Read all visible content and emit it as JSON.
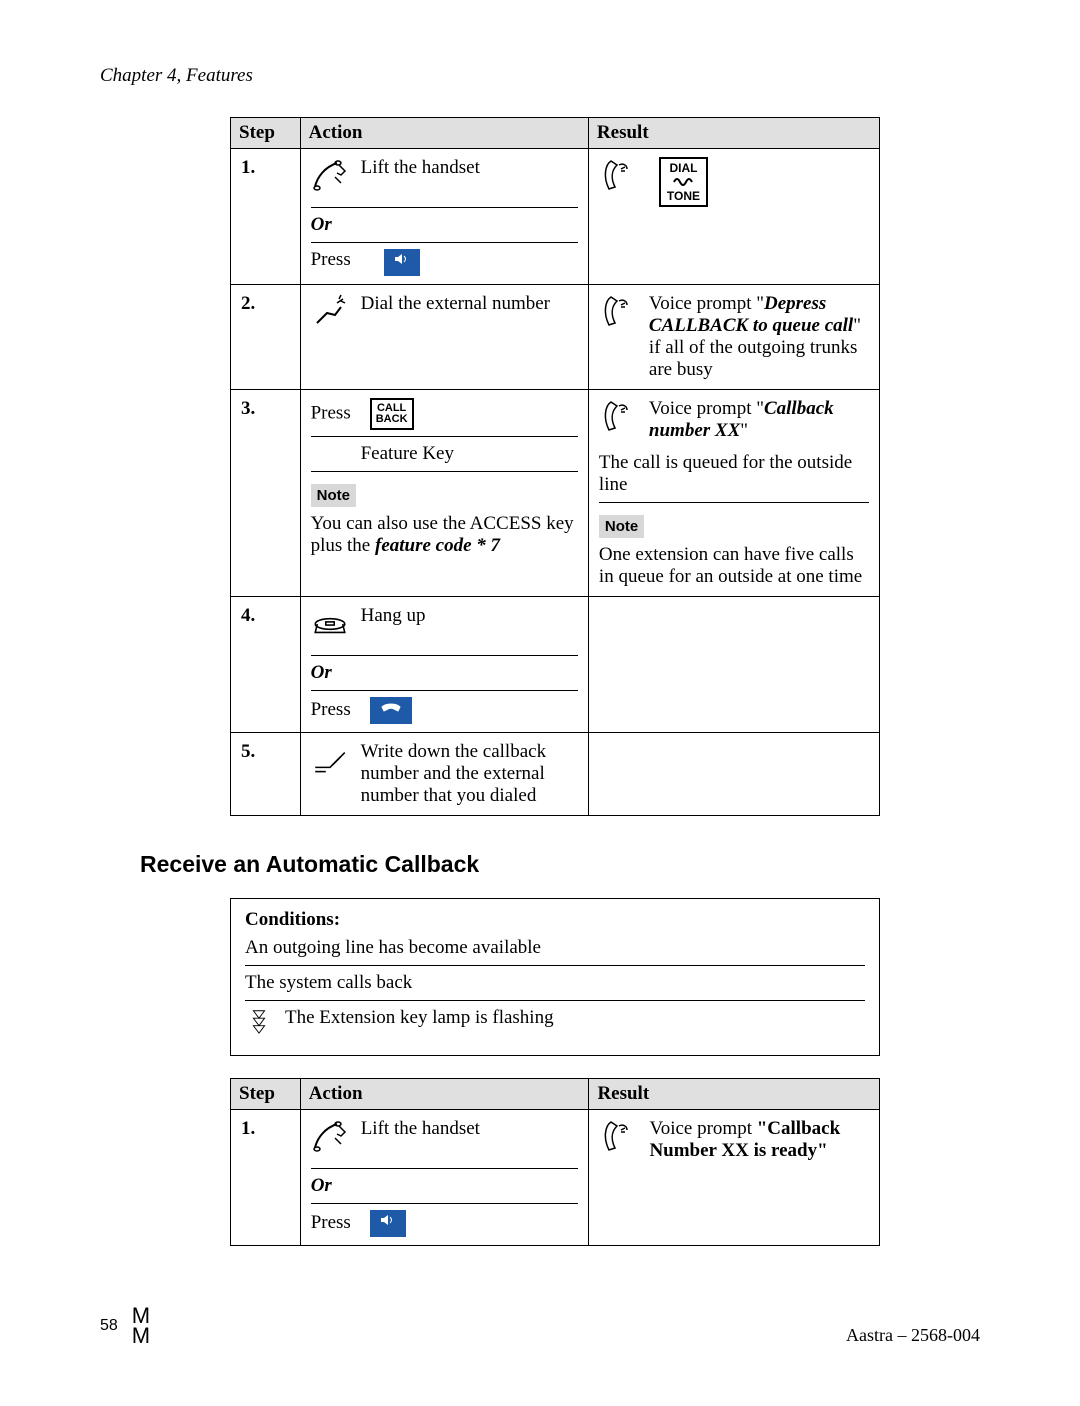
{
  "header": {
    "chapter": "Chapter 4, Features"
  },
  "table1": {
    "headers": {
      "step": "Step",
      "action": "Action",
      "result": "Result"
    },
    "rows": {
      "r1": {
        "step": "1.",
        "action_lift": "Lift the handset",
        "or": "Or",
        "action_press": "Press",
        "dialtone_top": "DIAL",
        "dialtone_bot": "TONE"
      },
      "r2": {
        "step": "2.",
        "action": "Dial the external number",
        "result_pre": "Voice prompt \"",
        "result_bi": "Depress CALLBACK to queue call",
        "result_post": "\" if all of the outgoing trunks are busy"
      },
      "r3": {
        "step": "3.",
        "action_press": "Press",
        "callback_top": "CALL",
        "callback_bot": "BACK",
        "feature_key": "Feature Key",
        "note_label": "Note",
        "note_text_1": "You can also use the ACCESS key plus the ",
        "note_text_bi": "feature code * 7",
        "result_pre": "Voice prompt \"",
        "result_bi": "Callback number XX",
        "result_post": "\"",
        "result_line2": "The call is queued for the outside line",
        "result_note_label": "Note",
        "result_note_text": "One extension can have five calls in queue for an outside at one time"
      },
      "r4": {
        "step": "4.",
        "hangup": "Hang up",
        "or": "Or",
        "press": "Press"
      },
      "r5": {
        "step": "5.",
        "text": "Write down the callback number and the external number that you dialed"
      }
    }
  },
  "section_title": "Receive an Automatic Callback",
  "conditions": {
    "header": "Conditions:",
    "c1": "An outgoing line has become available",
    "c2": "The system calls back",
    "c3": "The Extension key lamp is flashing"
  },
  "table2": {
    "headers": {
      "step": "Step",
      "action": "Action",
      "result": "Result"
    },
    "row1": {
      "step": "1.",
      "lift": "Lift the handset",
      "or": "Or",
      "press": "Press",
      "result_pre": "Voice prompt ",
      "result_bold": "\"Callback Number XX is ready\""
    }
  },
  "footer": {
    "page": "58",
    "logo_top": "M",
    "logo_bot": "M",
    "doc": "Aastra – 2568-004"
  }
}
